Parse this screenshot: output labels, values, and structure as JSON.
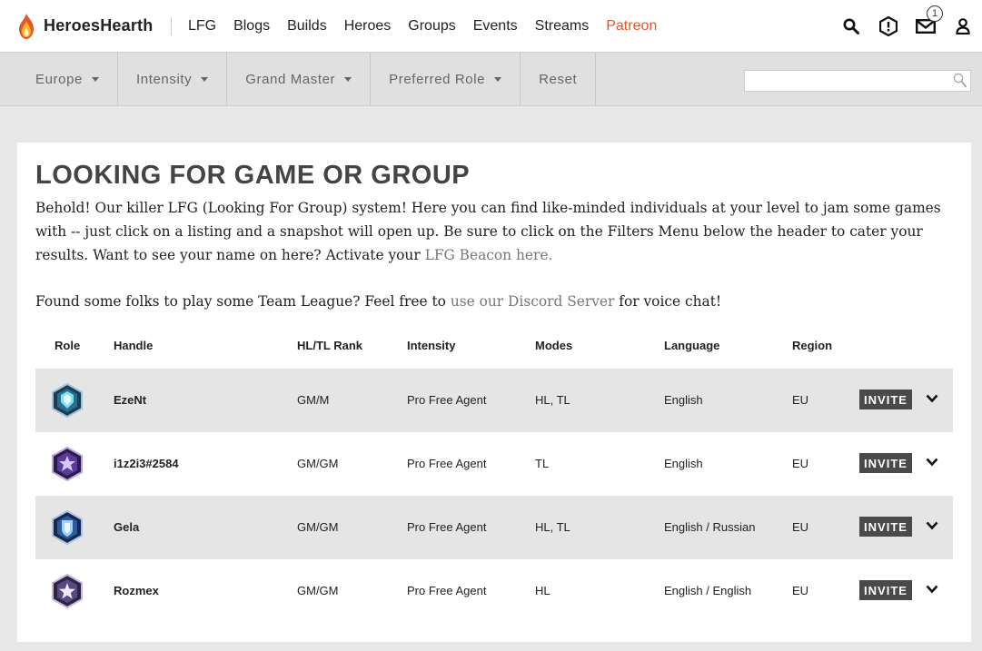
{
  "nav": {
    "brand": "HeroesHearth",
    "links": [
      "LFG",
      "Blogs",
      "Builds",
      "Heroes",
      "Groups",
      "Events",
      "Streams",
      "Patreon"
    ],
    "notification_count": "1",
    "accent_color": "#e2572a"
  },
  "filters": {
    "region": "Europe",
    "intensity": "Intensity",
    "rank": "Grand Master",
    "role": "Preferred Role",
    "reset": "Reset",
    "search_placeholder": ""
  },
  "page": {
    "title": "LOOKING FOR GAME OR GROUP",
    "intro_text": "Behold! Our killer LFG (Looking For Group) system! Here you can find like-minded individuals at your level to jam some games with -- just click on a listing and a snapshot will open up. Be sure to click on the Filters Menu below the header to cater your results. Want to see your name on here? Activate your ",
    "beacon_link": "LFG Beacon here.",
    "discord_prefix": "Found some folks to play some Team League? Feel free to ",
    "discord_link": "use our Discord Server",
    "discord_suffix": " for voice chat!"
  },
  "table": {
    "columns": [
      "Role",
      "Handle",
      "HL/TL Rank",
      "Intensity",
      "Modes",
      "Language",
      "Region"
    ],
    "invite_label": "INVITE",
    "rows": [
      {
        "role_icon": "tank-role-icon",
        "handle": "EzeNt",
        "rank": "GM/M",
        "intensity": "Pro Free Agent",
        "modes": "HL, TL",
        "language": "English",
        "region": "EU"
      },
      {
        "role_icon": "assassin-role-icon",
        "handle": "i1z2i3#2584",
        "rank": "GM/GM",
        "intensity": "Pro Free Agent",
        "modes": "TL",
        "language": "English",
        "region": "EU"
      },
      {
        "role_icon": "support-role-icon",
        "handle": "Gela",
        "rank": "GM/GM",
        "intensity": "Pro Free Agent",
        "modes": "HL, TL",
        "language": "English / Russian",
        "region": "EU"
      },
      {
        "role_icon": "flex-role-icon",
        "handle": "Rozmex",
        "rank": "GM/GM",
        "intensity": "Pro Free Agent",
        "modes": "HL",
        "language": "English / English",
        "region": "EU"
      }
    ]
  }
}
